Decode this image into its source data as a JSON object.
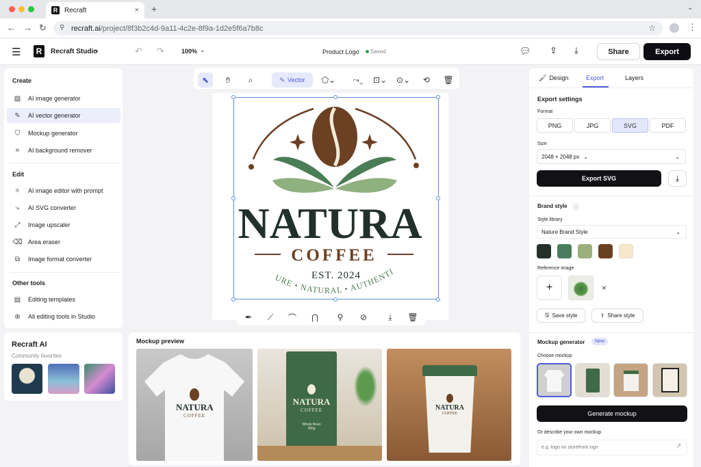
{
  "browser": {
    "tab_title": "Recraft",
    "new_tab": "+",
    "close_tab": "×",
    "url_host": "recraft.ai",
    "url_path": "/project/8f3b2c4d-9a11-4c2e-8f9a-1d2e5f6a7b8c",
    "window_controls": [
      "#ff5f57",
      "#febc2e",
      "#28c840"
    ]
  },
  "header": {
    "brand": "Recraft Studio",
    "zoom": "100%",
    "project_name": "Product Logo",
    "save_status": "Saved",
    "share_label": "Share",
    "export_label": "Export"
  },
  "left": {
    "create_title": "Create",
    "create_items": [
      "AI image generator",
      "AI vector generator",
      "Mockup generator",
      "AI background remover"
    ],
    "edit_title": "Edit",
    "edit_items": [
      "AI image editor with prompt",
      "AI SVG converter",
      "Image upscaler",
      "Area eraser",
      "Image format converter"
    ],
    "other_title": "Other tools",
    "other_items": [
      "Editing templates",
      "All editing tools in Studio"
    ],
    "recraft_ai_title": "Recraft AI",
    "community_label": "Community favorites"
  },
  "toolbar": {
    "vector_label": "Vector"
  },
  "logo": {
    "title": "NATURA",
    "subtitle": "COFFEE",
    "established": "EST. 2024",
    "tagline": "PURE • NATURAL • AUTHENTIC",
    "colors": {
      "dark": "#22302a",
      "brown": "#6b4023",
      "green": "#4a7d55",
      "light_green": "#8fb07f"
    }
  },
  "mockup_preview": {
    "title": "Mockup preview",
    "bag_small_text": "Whole Bean",
    "bag_weight": "250g"
  },
  "right": {
    "tabs": [
      "Design",
      "Export",
      "Layers"
    ],
    "export_settings_title": "Export settings",
    "format_label": "Format",
    "formats": [
      "PNG",
      "JPG",
      "SVG",
      "PDF"
    ],
    "size_label": "Size",
    "size_value": "2048 × 2048 px",
    "export_svg_label": "Export SVG",
    "brand_style_title": "Brand style",
    "style_library_label": "Style library",
    "style_library_value": "Nature Brand Style",
    "swatches": [
      "#243129",
      "#4a7d5e",
      "#9bb07d",
      "#6a4022",
      "#f5e8cc"
    ],
    "reference_label": "Reference image",
    "save_style_label": "Save style",
    "share_style_label": "Share style",
    "mockup_gen_title": "Mockup generator",
    "new_badge": "New",
    "choose_mockup_label": "Choose mockup",
    "generate_label": "Generate mockup",
    "describe_label": "Or describe your own mockup",
    "describe_placeholder": "e.g. logo on storefront sign"
  }
}
